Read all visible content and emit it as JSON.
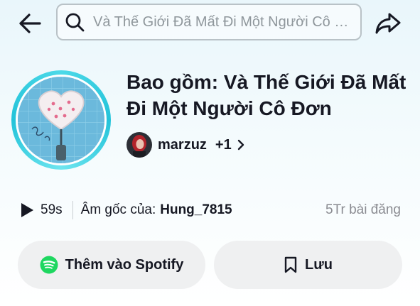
{
  "search": {
    "placeholder": "Và Thế Giới Đã Mất Đi Một Người Cô Đơn"
  },
  "sound": {
    "title": "Bao gồm: Và Thế Giới Đã Mất Đi Một Người Cô Đơn",
    "author": "marzuz",
    "author_extra": "+1",
    "duration": "59s",
    "origin_label": "Âm gốc của:",
    "origin_user": "Hung_7815",
    "post_count": "5Tr bài đăng"
  },
  "actions": {
    "spotify_label": "Thêm vào Spotify",
    "save_label": "Lưu"
  },
  "colors": {
    "spotify": "#1ed760",
    "cover_ring": "#23c3d9",
    "muted_text": "#8a8b91"
  },
  "icons": {
    "back": "arrow-left-icon",
    "search": "search-icon",
    "share": "share-arrow-icon",
    "play": "play-icon",
    "spotify": "spotify-icon",
    "bookmark": "bookmark-icon",
    "chevron": "chevron-right-icon"
  }
}
